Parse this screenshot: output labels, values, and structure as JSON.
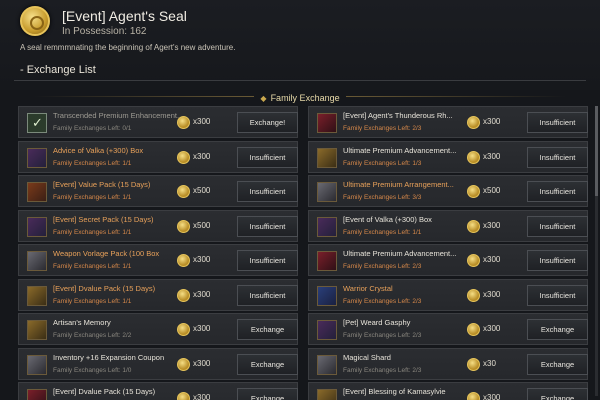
{
  "header": {
    "title": "[Event] Agent's Seal",
    "possession": "In Possession: 162",
    "description": "A seal remmmnating the beginning of Agert's new adventure.",
    "section_title": "- Exchange List"
  },
  "tab": {
    "label": "Family Exchange"
  },
  "items": [
    {
      "name": "Transcended Premium Enhancement...",
      "left": "Family Exchanges Left: 0/1",
      "cost": "x300",
      "button": "Exchange!",
      "icon": "checkmark-icon"
    },
    {
      "name": "[Event] Agent's Thunderous Rh...",
      "left": "Family Exchanges Left: 2/3",
      "cost": "x300",
      "button": "Insufficient",
      "icon": "thunder-box-icon"
    },
    {
      "name": "Advice of Valka (+300) Box",
      "left": "Family Exchanges Left: 1/1",
      "cost": "x300",
      "button": "Insufficient",
      "icon": "valka-box-icon"
    },
    {
      "name": "Ultimate Premium Advancement...",
      "left": "Family Exchanges Left: 1/3",
      "cost": "x300",
      "button": "Insufficient",
      "icon": "premium-box-icon"
    },
    {
      "name": "[Event] Value Pack (15 Days)",
      "left": "Family Exchanges Left: 1/1",
      "cost": "x500",
      "button": "Insufficient",
      "icon": "value-pack-icon"
    },
    {
      "name": "Ultimate Premium Arrangement...",
      "left": "Family Exchanges Left: 3/3",
      "cost": "x500",
      "button": "Insufficient",
      "icon": "arrangement-icon"
    },
    {
      "name": "[Event] Secret Pack (15 Days)",
      "left": "Family Exchanges Left: 1/1",
      "cost": "x500",
      "button": "Insufficient",
      "icon": "secret-pack-icon"
    },
    {
      "name": "[Event of Valka (+300) Box",
      "left": "Family Exchanges Left: 1/1",
      "cost": "x300",
      "button": "Insufficient",
      "icon": "valka-box-icon"
    },
    {
      "name": "Weapon Vorlage Pack (100 Box",
      "left": "Family Exchanges Left: 1/1",
      "cost": "x300",
      "button": "Insufficient",
      "icon": "weapon-pack-icon"
    },
    {
      "name": "Ultimate Premium Advancement...",
      "left": "Family Exchanges Left: 2/3",
      "cost": "x300",
      "button": "Insufficient",
      "icon": "crystal-icon"
    },
    {
      "name": "[Event] Dvalue Pack (15 Days)",
      "left": "Family Exchanges Left: 1/1",
      "cost": "x300",
      "button": "Insufficient",
      "icon": "chest-icon"
    },
    {
      "name": "Warrior Crystal",
      "left": "Family Exchanges Left: 2/3",
      "cost": "x300",
      "button": "Insufficient",
      "icon": "warrior-crystal-icon"
    },
    {
      "name": "Artisan's Memory",
      "left": "Family Exchanges Left: 2/2",
      "cost": "x300",
      "button": "Exchange",
      "icon": "memory-icon"
    },
    {
      "name": "[Pet] Weard Gasphy",
      "left": "Family Exchanges Left: 2/3",
      "cost": "x300",
      "button": "Exchange",
      "icon": "pet-icon"
    },
    {
      "name": "Inventory +16 Expansion Coupon",
      "left": "Family Exchanges Left: 1/0",
      "cost": "x300",
      "button": "Exchange",
      "icon": "coupon-icon"
    },
    {
      "name": "Magical Shard",
      "left": "Family Exchanges Left: 2/3",
      "cost": "x30",
      "button": "Exchange",
      "icon": "shard-icon"
    },
    {
      "name": "[Event] Dvalue Pack (15 Days)",
      "left": "Family Exchanges Left: 1/1",
      "cost": "x300",
      "button": "Exchange",
      "icon": "potion-icon"
    },
    {
      "name": "[Event] Blessing of Kamasylvie",
      "left": "Family Exchanges Left: 1/1",
      "cost": "x300",
      "button": "Exchange",
      "icon": "blessing-icon"
    }
  ],
  "colors": {
    "accent": "#c9a84e",
    "cost_coin": "#d8ab3a",
    "warning_text": "#d6884a"
  }
}
